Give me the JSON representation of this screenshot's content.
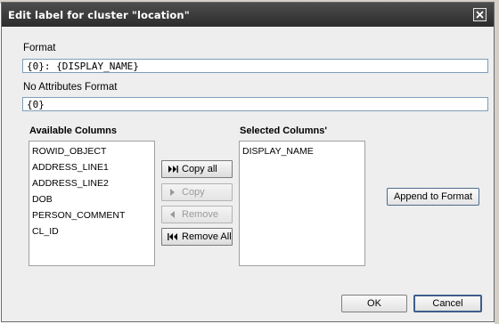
{
  "dialog": {
    "title": "Edit label for cluster \"location\""
  },
  "format": {
    "label": "Format",
    "value": "{0}: {DISPLAY_NAME}"
  },
  "no_attributes_format": {
    "label": "No Attributes Format",
    "value": "{0}"
  },
  "available_columns": {
    "heading": "Available Columns",
    "items": [
      "ROWID_OBJECT",
      "ADDRESS_LINE1",
      "ADDRESS_LINE2",
      "DOB",
      "PERSON_COMMENT",
      "CL_ID"
    ]
  },
  "selected_columns": {
    "heading": "Selected Columns'",
    "items": [
      "DISPLAY_NAME"
    ]
  },
  "transfer_buttons": {
    "copy_all": "Copy all",
    "copy": "Copy",
    "remove": "Remove",
    "remove_all": "Remove All"
  },
  "actions": {
    "append_to_format": "Append to Format",
    "ok": "OK",
    "cancel": "Cancel"
  },
  "colors": {
    "titlebar": "#3a3a3a",
    "dialog_bg": "#eeeeee",
    "field_border": "#7f9db9",
    "default_button_border": "#3c5f8a"
  }
}
